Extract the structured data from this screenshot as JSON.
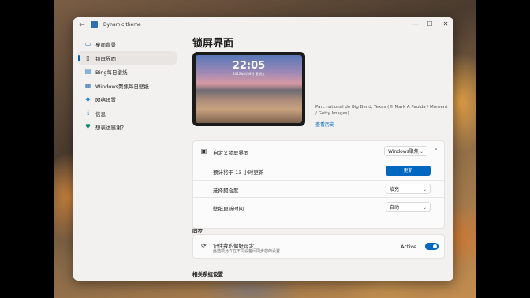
{
  "window": {
    "title": "Dynamic theme",
    "back_glyph": "←",
    "minimize_glyph": "—",
    "maximize_glyph": "☐",
    "close_glyph": "✕"
  },
  "sidebar": {
    "items": [
      {
        "label": "桌面背景",
        "icon": "desktop-icon",
        "glyph": "▭",
        "color": "#2e6fb0"
      },
      {
        "label": "锁屏界面",
        "icon": "lock-screen-icon",
        "glyph": "▯",
        "color": "#3a3a3a"
      },
      {
        "label": "Bing每日壁纸",
        "icon": "bing-icon",
        "glyph": "▤",
        "color": "#1f76c9"
      },
      {
        "label": "Windows聚焦每日壁纸",
        "icon": "windows-spotlight-icon",
        "glyph": "▦",
        "color": "#2b6cb0"
      },
      {
        "label": "网络设置",
        "icon": "network-icon",
        "glyph": "◆",
        "color": "#1a8cd8"
      },
      {
        "label": "信息",
        "icon": "info-icon",
        "glyph": "ℹ",
        "color": "#2d8fb3"
      },
      {
        "label": "想表达感谢？",
        "icon": "heart-icon",
        "glyph": "♥",
        "color": "#0f8a6c"
      }
    ]
  },
  "main": {
    "title": "锁屏界面",
    "preview": {
      "time": "22:05",
      "date": "2022年4月8日 星期五"
    },
    "credit": "Parc national de Big Bend, Texas (© Mark A Paulda / Moment / Getty Images)",
    "history_link": "查看历史",
    "lockscreen_card": {
      "label": "自定义锁屏界面",
      "dropdown_value": "Windows聚焦",
      "chevron_down": "⌄",
      "collapse_glyph": "˄",
      "rows": [
        {
          "label": "预计将于 13 小时更新",
          "button": "更新"
        },
        {
          "label": "选择契合度",
          "value": "填充"
        },
        {
          "label": "壁纸更新时间",
          "value": "自动"
        }
      ]
    },
    "sync": {
      "section": "同步",
      "label": "记住我的偏好设定",
      "sublabel": "此选项允许在不同设备间同步您的设置",
      "toggle_label": "Active",
      "toggle_on": true,
      "sync_glyph": "⟳"
    },
    "related_section": "相关系统设置"
  },
  "colors": {
    "accent": "#0067c0"
  }
}
